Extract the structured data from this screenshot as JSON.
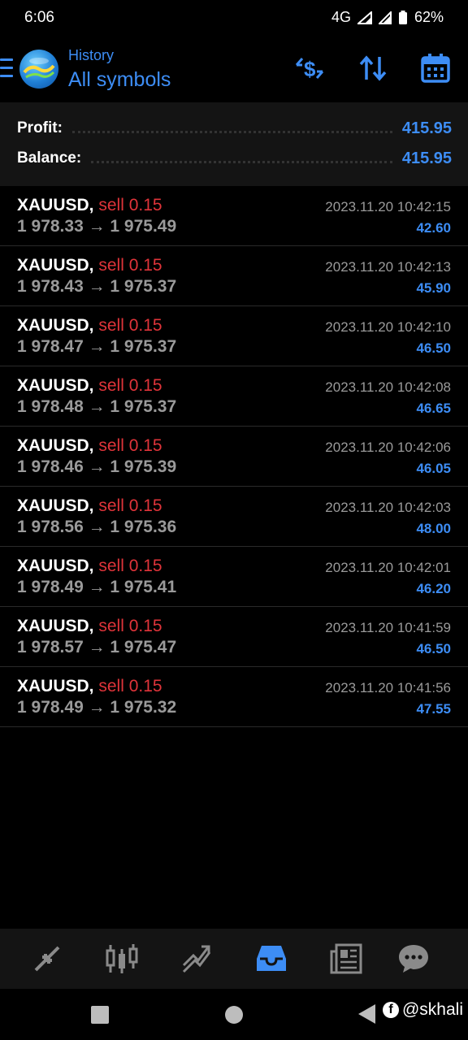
{
  "status_bar": {
    "time": "6:06",
    "network": "4G",
    "battery": "62%"
  },
  "header": {
    "title_small": "History",
    "title_big": "All symbols",
    "icons": [
      "menu-icon",
      "dollar-swap-icon",
      "sort-icon",
      "calendar-icon"
    ]
  },
  "summary": {
    "profit_label": "Profit:",
    "profit_value": "415.95",
    "balance_label": "Balance:",
    "balance_value": "415.95"
  },
  "trades": [
    {
      "symbol": "XAUUSD,",
      "side": "sell 0.15",
      "prices": "1 978.33 → 1 975.49",
      "time": "2023.11.20 10:42:15",
      "profit": "42.60"
    },
    {
      "symbol": "XAUUSD,",
      "side": "sell 0.15",
      "prices": "1 978.43 → 1 975.37",
      "time": "2023.11.20 10:42:13",
      "profit": "45.90"
    },
    {
      "symbol": "XAUUSD,",
      "side": "sell 0.15",
      "prices": "1 978.47 → 1 975.37",
      "time": "2023.11.20 10:42:10",
      "profit": "46.50"
    },
    {
      "symbol": "XAUUSD,",
      "side": "sell 0.15",
      "prices": "1 978.48 → 1 975.37",
      "time": "2023.11.20 10:42:08",
      "profit": "46.65"
    },
    {
      "symbol": "XAUUSD,",
      "side": "sell 0.15",
      "prices": "1 978.46 → 1 975.39",
      "time": "2023.11.20 10:42:06",
      "profit": "46.05"
    },
    {
      "symbol": "XAUUSD,",
      "side": "sell 0.15",
      "prices": "1 978.56 → 1 975.36",
      "time": "2023.11.20 10:42:03",
      "profit": "48.00"
    },
    {
      "symbol": "XAUUSD,",
      "side": "sell 0.15",
      "prices": "1 978.49 → 1 975.41",
      "time": "2023.11.20 10:42:01",
      "profit": "46.20"
    },
    {
      "symbol": "XAUUSD,",
      "side": "sell 0.15",
      "prices": "1 978.57 → 1 975.47",
      "time": "2023.11.20 10:41:59",
      "profit": "46.50"
    },
    {
      "symbol": "XAUUSD,",
      "side": "sell 0.15",
      "prices": "1 978.49 → 1 975.32",
      "time": "2023.11.20 10:41:56",
      "profit": "47.55"
    }
  ],
  "bottom_nav": {
    "items": [
      "quotes-icon",
      "chart-icon",
      "trade-icon",
      "history-icon",
      "news-icon",
      "chat-icon"
    ],
    "active": "history-icon"
  },
  "watermark": {
    "text": "@skhali"
  },
  "colors": {
    "accent": "#3d8df5",
    "sell": "#e0343a",
    "muted": "#9a9a9a",
    "background": "#000000",
    "panel": "#141414"
  }
}
